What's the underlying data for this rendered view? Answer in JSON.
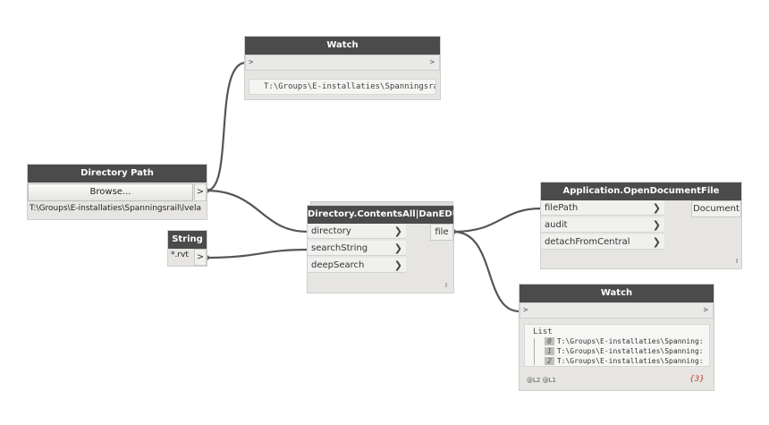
{
  "nodes": {
    "watch_top": {
      "title": "Watch",
      "in_arrow": ">",
      "out_arrow": ">",
      "value": "T:\\Groups\\E-installaties\\Spanningsrail\\"
    },
    "directory_path": {
      "title": "Directory Path",
      "browse_label": "Browse...",
      "out_arrow": ">",
      "path_value": "T:\\Groups\\E-installaties\\Spanningsrail\\lvela"
    },
    "string": {
      "title": "String",
      "value": "*.rvt",
      "out_arrow": ">"
    },
    "contents_all": {
      "title": "Directory.ContentsAll|DanEDU",
      "inputs": [
        "directory",
        "searchString",
        "deepSearch"
      ],
      "output": "file",
      "status": "I"
    },
    "open_document": {
      "title": "Application.OpenDocumentFile",
      "inputs": [
        "filePath",
        "audit",
        "detachFromCentral"
      ],
      "output": "Document",
      "status": "I"
    },
    "watch_list": {
      "title": "Watch",
      "in_arrow": ">",
      "out_arrow": ">",
      "list_header": "List",
      "items": [
        {
          "index": "0",
          "value": "T:\\Groups\\E-installaties\\Spanning:"
        },
        {
          "index": "1",
          "value": "T:\\Groups\\E-installaties\\Spanning:"
        },
        {
          "index": "2",
          "value": "T:\\Groups\\E-installaties\\Spanning:"
        }
      ],
      "levels": "@L2 @L1",
      "count": "{3}"
    }
  },
  "colors": {
    "header": "#4b4b4b",
    "body": "#e6e5e2",
    "wire": "#555555",
    "count": "#c0392b"
  }
}
